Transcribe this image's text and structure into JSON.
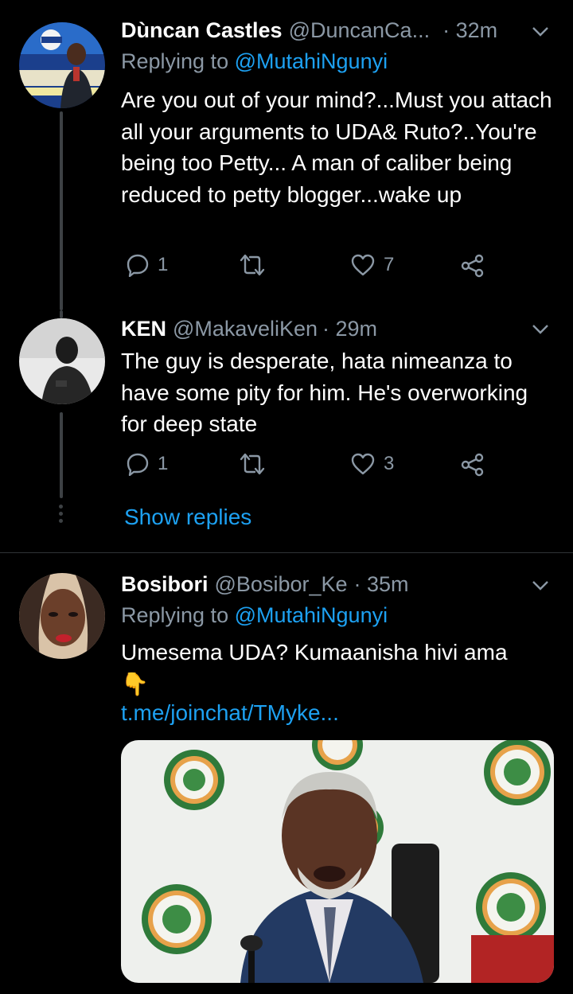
{
  "tweets": [
    {
      "name": "Dùncan Castles",
      "handle": "@DuncanCa...",
      "time": "· 32m",
      "replying_prefix": "Replying to ",
      "replying_to": "@MutahiNgunyi",
      "body": "Are you out of your mind?...Must you attach all your arguments to  UDA& Ruto?..You're being too Petty... A man of caliber being reduced to petty blogger...wake up",
      "reply_count": "1",
      "like_count": "7"
    },
    {
      "name": "KEN",
      "handle": "@MakaveliKen",
      "time": "· 29m",
      "body": "The guy is desperate, hata nimeanza to have some pity for him. He's overworking for deep state",
      "reply_count": "1",
      "like_count": "3",
      "show_replies": "Show replies"
    },
    {
      "name": "Bosibori",
      "handle": "@Bosibor_Ke",
      "time": "· 35m",
      "replying_prefix": "Replying to ",
      "replying_to": "@MutahiNgunyi",
      "body": "Umesema UDA?  Kumaanisha hivi ama",
      "emoji": "👇",
      "link": "t.me/joinchat/TMyke..."
    }
  ],
  "colors": {
    "background": "#000000",
    "secondary_text": "#8b98a5",
    "link": "#1da1f2",
    "thread_line": "#3d4144"
  },
  "icons": [
    "reply-icon",
    "retweet-icon",
    "like-icon",
    "share-icon",
    "chevron-down-icon"
  ]
}
